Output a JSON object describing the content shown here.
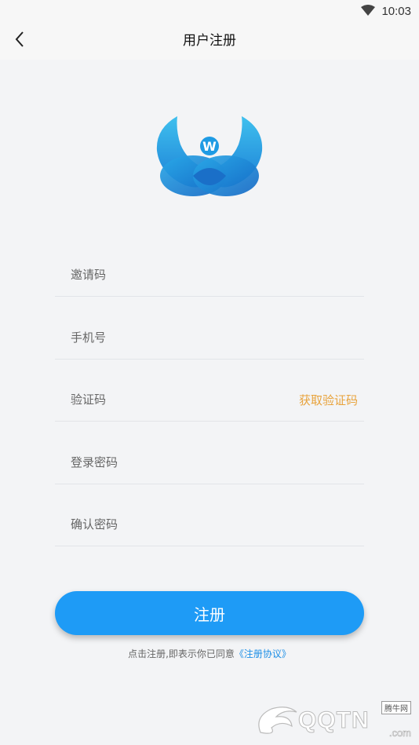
{
  "status": {
    "time": "10:03"
  },
  "nav": {
    "title": "用户注册"
  },
  "form": {
    "invite_placeholder": "邀请码",
    "phone_placeholder": "手机号",
    "code_placeholder": "验证码",
    "get_code_label": "获取验证码",
    "password_placeholder": "登录密码",
    "confirm_placeholder": "确认密码",
    "register_label": "注册"
  },
  "agreement": {
    "prefix": "点击注册,即表示你已同意",
    "link": "《注册协议》"
  },
  "watermark": {
    "brand": "QQTN",
    "domain": ".com",
    "site": "腾牛网"
  },
  "colors": {
    "primary": "#1e9bf6",
    "accent": "#e8a33c",
    "link": "#1e8fe6",
    "background": "#f3f4f6"
  }
}
